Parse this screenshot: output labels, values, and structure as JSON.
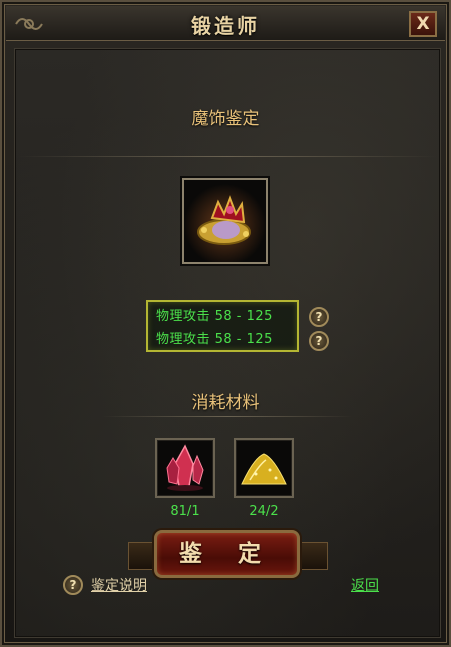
{
  "window": {
    "title": "锻造师",
    "close_label": "X"
  },
  "section": {
    "title": "魔饰鉴定"
  },
  "item": {
    "icon": "jeweled-crown-icon"
  },
  "stats": [
    {
      "text": "物理攻击 58 - 125",
      "help_label": "?"
    },
    {
      "text": "物理攻击 58 - 125",
      "help_label": "?"
    }
  ],
  "materials": {
    "title": "消耗材料",
    "items": [
      {
        "icon": "red-crystal-icon",
        "count": "81/1"
      },
      {
        "icon": "gold-powder-icon",
        "count": "24/2"
      }
    ]
  },
  "actions": {
    "identify_label": "鉴 定",
    "help_label": "?",
    "instructions_label": "鉴定说明",
    "back_label": "返回"
  },
  "colors": {
    "title_text": "#e8d3a4",
    "section_text": "#e9c27a",
    "stat_text": "#4be04b",
    "stat_border": "#b4b633",
    "button_red": "#7a1d12"
  }
}
